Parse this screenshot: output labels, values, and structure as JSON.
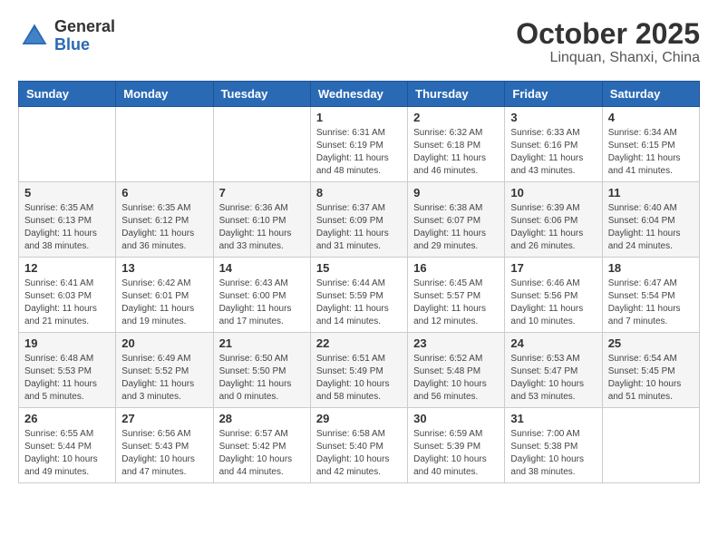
{
  "header": {
    "logo_general": "General",
    "logo_blue": "Blue",
    "title": "October 2025",
    "subtitle": "Linquan, Shanxi, China"
  },
  "weekdays": [
    "Sunday",
    "Monday",
    "Tuesday",
    "Wednesday",
    "Thursday",
    "Friday",
    "Saturday"
  ],
  "weeks": [
    [
      {
        "day": "",
        "info": ""
      },
      {
        "day": "",
        "info": ""
      },
      {
        "day": "",
        "info": ""
      },
      {
        "day": "1",
        "info": "Sunrise: 6:31 AM\nSunset: 6:19 PM\nDaylight: 11 hours\nand 48 minutes."
      },
      {
        "day": "2",
        "info": "Sunrise: 6:32 AM\nSunset: 6:18 PM\nDaylight: 11 hours\nand 46 minutes."
      },
      {
        "day": "3",
        "info": "Sunrise: 6:33 AM\nSunset: 6:16 PM\nDaylight: 11 hours\nand 43 minutes."
      },
      {
        "day": "4",
        "info": "Sunrise: 6:34 AM\nSunset: 6:15 PM\nDaylight: 11 hours\nand 41 minutes."
      }
    ],
    [
      {
        "day": "5",
        "info": "Sunrise: 6:35 AM\nSunset: 6:13 PM\nDaylight: 11 hours\nand 38 minutes."
      },
      {
        "day": "6",
        "info": "Sunrise: 6:35 AM\nSunset: 6:12 PM\nDaylight: 11 hours\nand 36 minutes."
      },
      {
        "day": "7",
        "info": "Sunrise: 6:36 AM\nSunset: 6:10 PM\nDaylight: 11 hours\nand 33 minutes."
      },
      {
        "day": "8",
        "info": "Sunrise: 6:37 AM\nSunset: 6:09 PM\nDaylight: 11 hours\nand 31 minutes."
      },
      {
        "day": "9",
        "info": "Sunrise: 6:38 AM\nSunset: 6:07 PM\nDaylight: 11 hours\nand 29 minutes."
      },
      {
        "day": "10",
        "info": "Sunrise: 6:39 AM\nSunset: 6:06 PM\nDaylight: 11 hours\nand 26 minutes."
      },
      {
        "day": "11",
        "info": "Sunrise: 6:40 AM\nSunset: 6:04 PM\nDaylight: 11 hours\nand 24 minutes."
      }
    ],
    [
      {
        "day": "12",
        "info": "Sunrise: 6:41 AM\nSunset: 6:03 PM\nDaylight: 11 hours\nand 21 minutes."
      },
      {
        "day": "13",
        "info": "Sunrise: 6:42 AM\nSunset: 6:01 PM\nDaylight: 11 hours\nand 19 minutes."
      },
      {
        "day": "14",
        "info": "Sunrise: 6:43 AM\nSunset: 6:00 PM\nDaylight: 11 hours\nand 17 minutes."
      },
      {
        "day": "15",
        "info": "Sunrise: 6:44 AM\nSunset: 5:59 PM\nDaylight: 11 hours\nand 14 minutes."
      },
      {
        "day": "16",
        "info": "Sunrise: 6:45 AM\nSunset: 5:57 PM\nDaylight: 11 hours\nand 12 minutes."
      },
      {
        "day": "17",
        "info": "Sunrise: 6:46 AM\nSunset: 5:56 PM\nDaylight: 11 hours\nand 10 minutes."
      },
      {
        "day": "18",
        "info": "Sunrise: 6:47 AM\nSunset: 5:54 PM\nDaylight: 11 hours\nand 7 minutes."
      }
    ],
    [
      {
        "day": "19",
        "info": "Sunrise: 6:48 AM\nSunset: 5:53 PM\nDaylight: 11 hours\nand 5 minutes."
      },
      {
        "day": "20",
        "info": "Sunrise: 6:49 AM\nSunset: 5:52 PM\nDaylight: 11 hours\nand 3 minutes."
      },
      {
        "day": "21",
        "info": "Sunrise: 6:50 AM\nSunset: 5:50 PM\nDaylight: 11 hours\nand 0 minutes."
      },
      {
        "day": "22",
        "info": "Sunrise: 6:51 AM\nSunset: 5:49 PM\nDaylight: 10 hours\nand 58 minutes."
      },
      {
        "day": "23",
        "info": "Sunrise: 6:52 AM\nSunset: 5:48 PM\nDaylight: 10 hours\nand 56 minutes."
      },
      {
        "day": "24",
        "info": "Sunrise: 6:53 AM\nSunset: 5:47 PM\nDaylight: 10 hours\nand 53 minutes."
      },
      {
        "day": "25",
        "info": "Sunrise: 6:54 AM\nSunset: 5:45 PM\nDaylight: 10 hours\nand 51 minutes."
      }
    ],
    [
      {
        "day": "26",
        "info": "Sunrise: 6:55 AM\nSunset: 5:44 PM\nDaylight: 10 hours\nand 49 minutes."
      },
      {
        "day": "27",
        "info": "Sunrise: 6:56 AM\nSunset: 5:43 PM\nDaylight: 10 hours\nand 47 minutes."
      },
      {
        "day": "28",
        "info": "Sunrise: 6:57 AM\nSunset: 5:42 PM\nDaylight: 10 hours\nand 44 minutes."
      },
      {
        "day": "29",
        "info": "Sunrise: 6:58 AM\nSunset: 5:40 PM\nDaylight: 10 hours\nand 42 minutes."
      },
      {
        "day": "30",
        "info": "Sunrise: 6:59 AM\nSunset: 5:39 PM\nDaylight: 10 hours\nand 40 minutes."
      },
      {
        "day": "31",
        "info": "Sunrise: 7:00 AM\nSunset: 5:38 PM\nDaylight: 10 hours\nand 38 minutes."
      },
      {
        "day": "",
        "info": ""
      }
    ]
  ]
}
